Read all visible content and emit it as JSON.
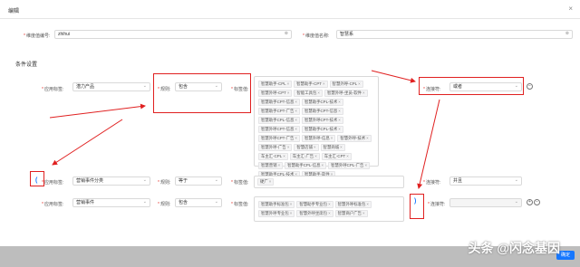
{
  "dialog": {
    "title": "编辑"
  },
  "top": {
    "dim_code_label": "维度值编号:",
    "dim_code_value": "zhihui",
    "dim_name_label": "维度值名称:",
    "dim_name_value": "智慧系"
  },
  "section_title": "条件设置",
  "row1": {
    "app_label": "应用标签:",
    "app_value": "潜力产品",
    "rule_label": "规则:",
    "rule_value": "包含",
    "tagval_label": "标签值:",
    "tags": [
      "智慧助手-CPL",
      "智慧助手-CPT",
      "智慧外呼-CPL",
      "智慧外呼-CPT",
      "智能工具包",
      "智慧外呼-坐员-软件",
      "智慧助手CPT-信息",
      "智慧助手CPL-技术",
      "智慧助手CPT-广告",
      "智慧助手CPT-信息",
      "智慧助手CPL-信息",
      "智慧外呼CPT-技术",
      "智慧外呼CPT-信息",
      "智慧助手CPL-技术",
      "智慧外呼CPT-广告",
      "智慧外呼-信息",
      "智慧外呼-技术",
      "智慧外呼-广告",
      "智慧店铺",
      "智慧商城",
      "车主汇-CPL",
      "车主汇-广告",
      "车主汇-CPT",
      "智慧营销",
      "智慧助手CPL-信息",
      "智慧外呼CPL-广告",
      "智慧助手CPL-技术",
      "智慧助手-软件"
    ],
    "connector_label": "连接符:",
    "connector_value": "或者"
  },
  "row2": {
    "paren_open": "(",
    "app_label": "应用标签:",
    "app_value": "营销事件分类",
    "rule_label": "规则:",
    "rule_value": "等于",
    "tagval_label": "标签值:",
    "tags": [
      "硬广"
    ],
    "connector_label": "连接符:",
    "connector_value": "并且"
  },
  "row3": {
    "app_label": "应用标签:",
    "app_value": "营销事件",
    "rule_label": "规则:",
    "rule_value": "包含",
    "tagval_label": "标签值:",
    "tags": [
      "智慧助手标准包",
      "智慧助手专业包",
      "智慧外呼标准包",
      "智慧外呼专业包",
      "智慧外呼坐席包",
      "智慧商户广告"
    ],
    "paren_close": ")",
    "connector_label": "连接符:",
    "connector_value": ""
  },
  "icons": {
    "suffix": "⊗",
    "chevron": "⌄",
    "plus": "+",
    "minus": "−",
    "close": "×"
  },
  "footer": {
    "ok_label": "确定"
  },
  "watermark": "头条 @闪念基因",
  "colors": {
    "accent": "#1677ff",
    "annotation": "#e02020"
  }
}
